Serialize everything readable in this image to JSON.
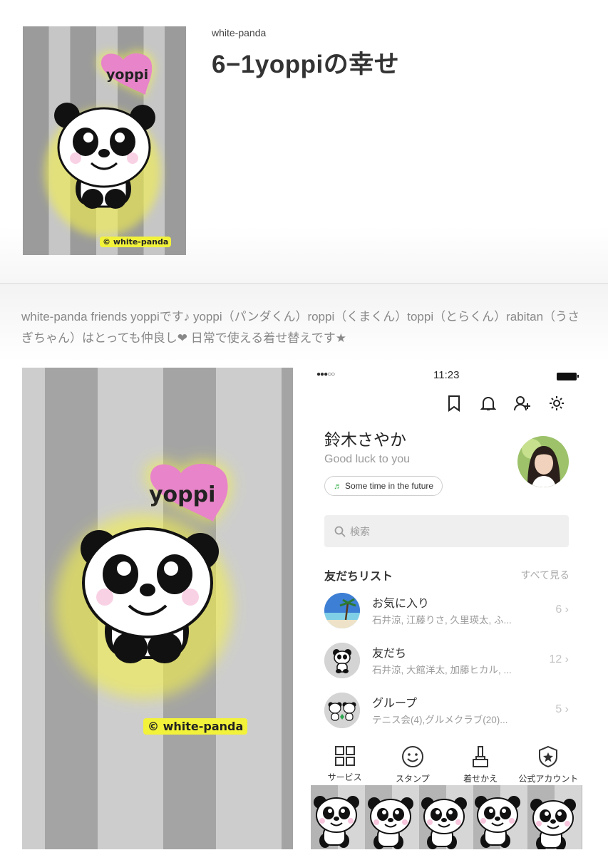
{
  "header": {
    "author": "white-panda",
    "title": "6−1yoppiの幸せ"
  },
  "artwork": {
    "heart_text": "yoppi",
    "copyright": "© white-panda"
  },
  "description": "white-panda friends yoppiです♪ yoppi（パンダくん）roppi（くまくん）toppi（とらくん）rabitan（うさぎちゃん）はとっても仲良し❤ 日常で使える着せ替えです★",
  "phone": {
    "status_bar": {
      "signal": "●●●○○",
      "time": "11:23"
    },
    "top_icons": [
      "bookmark-icon",
      "bell-icon",
      "add-friend-icon",
      "gear-icon"
    ],
    "profile": {
      "name": "鈴木さやか",
      "status_message": "Good luck to you",
      "music": "Some time in the future"
    },
    "search": {
      "placeholder": "検索"
    },
    "friends": {
      "header": "友だちリスト",
      "see_all": "すべて見る",
      "rows": [
        {
          "title": "お気に入り",
          "subtitle": "石井涼, 江藤りさ, 久里瑛太, ふ...",
          "count": "6"
        },
        {
          "title": "友だち",
          "subtitle": "石井涼, 大館洋太, 加藤ヒカル, ...",
          "count": "12"
        },
        {
          "title": "グループ",
          "subtitle": "テニス会(4),グルメクラブ(20)...",
          "count": "5"
        }
      ]
    },
    "tabs": [
      {
        "label": "サービス",
        "icon": "grid-icon"
      },
      {
        "label": "スタンプ",
        "icon": "smiley-icon"
      },
      {
        "label": "着せかえ",
        "icon": "brush-icon"
      },
      {
        "label": "公式アカウント",
        "icon": "shield-star-icon"
      }
    ]
  },
  "colors": {
    "stripe_dark": "#9b9b9b",
    "stripe_light": "#c6c6c6",
    "heart_pink": "#e884c9",
    "glow_yellow": "#f4f24a",
    "music_note_green": "#3fb34f"
  }
}
